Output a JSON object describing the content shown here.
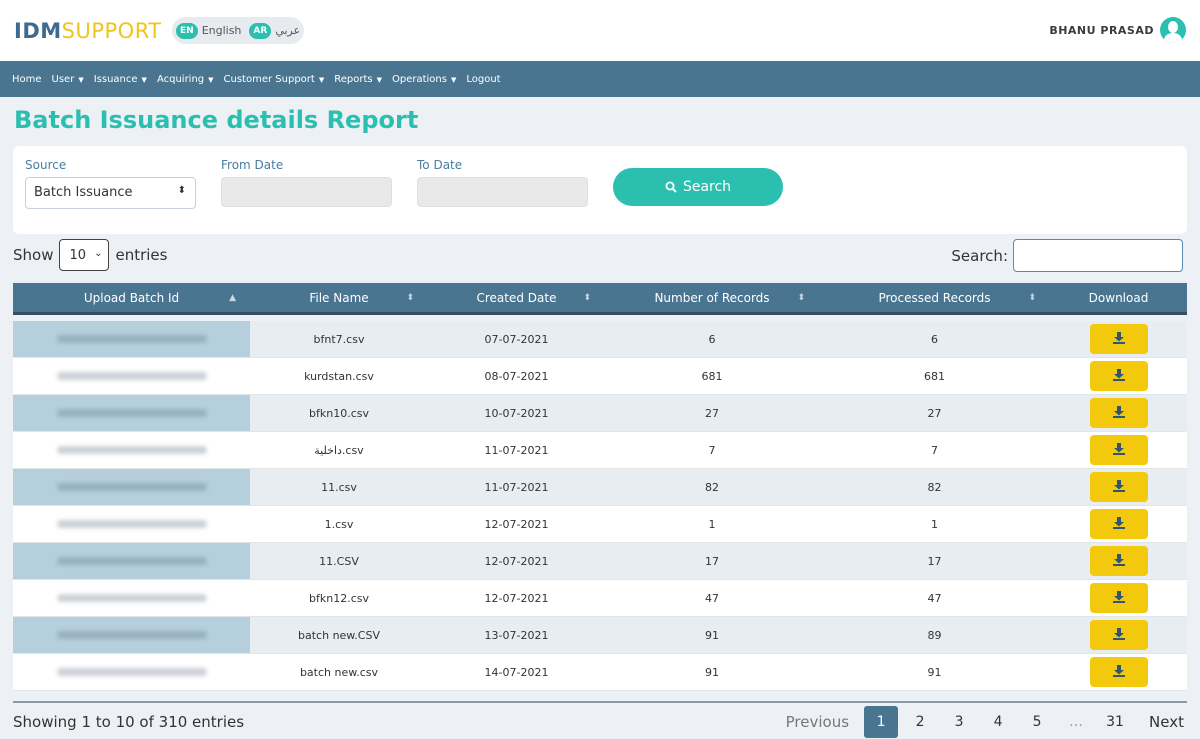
{
  "brand": {
    "part1": "IDM",
    "part2": "SUPPORT"
  },
  "language": {
    "en_badge": "EN",
    "en_label": "English",
    "ar_badge": "AR",
    "ar_label": "عربي"
  },
  "user": {
    "name": "BHANU PRASAD"
  },
  "nav": {
    "items": [
      {
        "label": "Home",
        "dropdown": false
      },
      {
        "label": "User",
        "dropdown": true
      },
      {
        "label": "Issuance",
        "dropdown": true
      },
      {
        "label": "Acquiring",
        "dropdown": true
      },
      {
        "label": "Customer Support",
        "dropdown": true
      },
      {
        "label": "Reports",
        "dropdown": true
      },
      {
        "label": "Operations",
        "dropdown": true
      },
      {
        "label": "Logout",
        "dropdown": false
      }
    ]
  },
  "page": {
    "title": "Batch Issuance details Report"
  },
  "filters": {
    "source_label": "Source",
    "source_value": "Batch Issuance",
    "from_label": "From Date",
    "to_label": "To Date",
    "search_button": "Search"
  },
  "controls": {
    "show_label": "Show",
    "entries_value": "10",
    "entries_label": "entries",
    "search_label": "Search:"
  },
  "table": {
    "headers": [
      "Upload Batch Id",
      "File Name",
      "Created Date",
      "Number of Records",
      "Processed Records",
      "Download"
    ],
    "rows": [
      {
        "file": "bfnt7.csv",
        "date": "07-07-2021",
        "records": "6",
        "processed": "6"
      },
      {
        "file": "kurdstan.csv",
        "date": "08-07-2021",
        "records": "681",
        "processed": "681"
      },
      {
        "file": "bfkn10.csv",
        "date": "10-07-2021",
        "records": "27",
        "processed": "27"
      },
      {
        "file": "داخلية.csv",
        "date": "11-07-2021",
        "records": "7",
        "processed": "7"
      },
      {
        "file": "11.csv",
        "date": "11-07-2021",
        "records": "82",
        "processed": "82"
      },
      {
        "file": "1.csv",
        "date": "12-07-2021",
        "records": "1",
        "processed": "1"
      },
      {
        "file": "11.CSV",
        "date": "12-07-2021",
        "records": "17",
        "processed": "17"
      },
      {
        "file": "bfkn12.csv",
        "date": "12-07-2021",
        "records": "47",
        "processed": "47"
      },
      {
        "file": "batch new.CSV",
        "date": "13-07-2021",
        "records": "91",
        "processed": "89"
      },
      {
        "file": "batch new.csv",
        "date": "14-07-2021",
        "records": "91",
        "processed": "91"
      }
    ]
  },
  "footer": {
    "info": "Showing 1 to 10 of 310 entries",
    "previous": "Previous",
    "next": "Next",
    "pages": [
      "1",
      "2",
      "3",
      "4",
      "5",
      "…",
      "31"
    ],
    "active_page": "1"
  },
  "colors": {
    "accent": "#2bbfb0",
    "nav": "#4a7591",
    "download": "#f2c90c"
  }
}
